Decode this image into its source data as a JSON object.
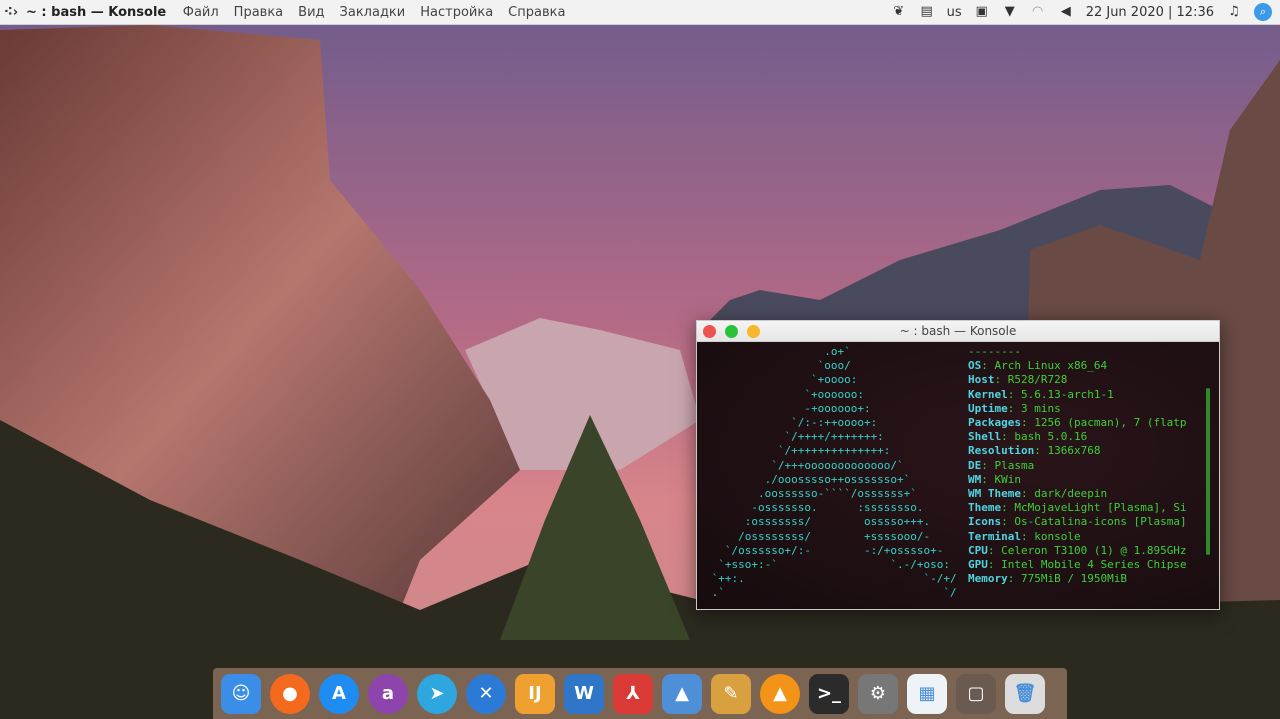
{
  "topbar": {
    "launcher_icon": "launcher-icon",
    "app_title": "~ : bash — Konsole",
    "menus": [
      "Файл",
      "Правка",
      "Вид",
      "Закладки",
      "Настройка",
      "Справка"
    ],
    "keyboard_layout": "us",
    "datetime": "22 Jun 2020 | 12:36"
  },
  "konsole": {
    "title": "~ : bash — Konsole",
    "art": [
      "                  .o+`",
      "                 `ooo/",
      "                `+oooo:",
      "               `+oooooo:",
      "               -+oooooo+:",
      "             `/:-:++oooo+:",
      "            `/++++/+++++++:",
      "           `/++++++++++++++:",
      "          `/+++ooooooooooooo/`",
      "         ./ooosssso++osssssso+`",
      "        .oossssso-````/ossssss+`",
      "       -osssssso.      :ssssssso.",
      "      :osssssss/        osssso+++.",
      "     /ossssssss/        +ssssooo/-",
      "   `/ossssso+/:-        -:/+osssso+-",
      "  `+sso+:-`                 `.-/+oso:",
      " `++:.                           `-/+/",
      " .`                                 `/"
    ],
    "separator": "--------",
    "info": [
      {
        "k": "OS",
        "v": "Arch Linux x86_64"
      },
      {
        "k": "Host",
        "v": "R528/R728"
      },
      {
        "k": "Kernel",
        "v": "5.6.13-arch1-1"
      },
      {
        "k": "Uptime",
        "v": "3 mins"
      },
      {
        "k": "Packages",
        "v": "1256 (pacman), 7 (flatp"
      },
      {
        "k": "Shell",
        "v": "bash 5.0.16"
      },
      {
        "k": "Resolution",
        "v": "1366x768"
      },
      {
        "k": "DE",
        "v": "Plasma"
      },
      {
        "k": "WM",
        "v": "KWin"
      },
      {
        "k": "WM Theme",
        "v": "dark/deepin"
      },
      {
        "k": "Theme",
        "v": "McMojaveLight [Plasma], Si"
      },
      {
        "k": "Icons",
        "v": "Os-Catalina-icons [Plasma]"
      },
      {
        "k": "Terminal",
        "v": "konsole"
      },
      {
        "k": "CPU",
        "v": "Celeron T3100 (1) @ 1.895GHz"
      },
      {
        "k": "GPU",
        "v": "Intel Mobile 4 Series Chipse"
      },
      {
        "k": "Memory",
        "v": "775MiB / 1950MiB"
      }
    ]
  },
  "dock": [
    {
      "name": "finder",
      "glyph": "☺",
      "bg": "#3b8ee8",
      "round": false
    },
    {
      "name": "firefox",
      "glyph": "●",
      "bg": "#f36a1f",
      "round": true
    },
    {
      "name": "app-store",
      "glyph": "A",
      "bg": "#1e8cf0",
      "round": true
    },
    {
      "name": "anydesk",
      "glyph": "a",
      "bg": "#8e44ad",
      "round": true
    },
    {
      "name": "telegram",
      "glyph": "➤",
      "bg": "#2ea6e0",
      "round": true
    },
    {
      "name": "vscode",
      "glyph": "✕",
      "bg": "#2b7bd6",
      "round": true
    },
    {
      "name": "ide",
      "glyph": "IJ",
      "bg": "#f0a030",
      "round": false
    },
    {
      "name": "word",
      "glyph": "W",
      "bg": "#2f75c8",
      "round": false
    },
    {
      "name": "pdf-reader",
      "glyph": "⅄",
      "bg": "#d93a35",
      "round": false
    },
    {
      "name": "image-viewer",
      "glyph": "▲",
      "bg": "#4f8fd8",
      "round": false
    },
    {
      "name": "image-editor",
      "glyph": "✎",
      "bg": "#d9a040",
      "round": false
    },
    {
      "name": "vlc",
      "glyph": "▲",
      "bg": "#f39318",
      "round": true
    },
    {
      "name": "terminal",
      "glyph": ">_",
      "bg": "#2b2b2b",
      "round": false
    },
    {
      "name": "system-settings",
      "glyph": "⚙",
      "bg": "#777",
      "round": false
    },
    {
      "name": "file-manager",
      "glyph": "▦",
      "bg": "#eef3f8",
      "round": false
    },
    {
      "name": "desktop",
      "glyph": "▢",
      "bg": "#6a5a50",
      "round": false
    },
    {
      "name": "trash",
      "glyph": "🗑",
      "bg": "#dcdcdc",
      "round": false
    }
  ]
}
